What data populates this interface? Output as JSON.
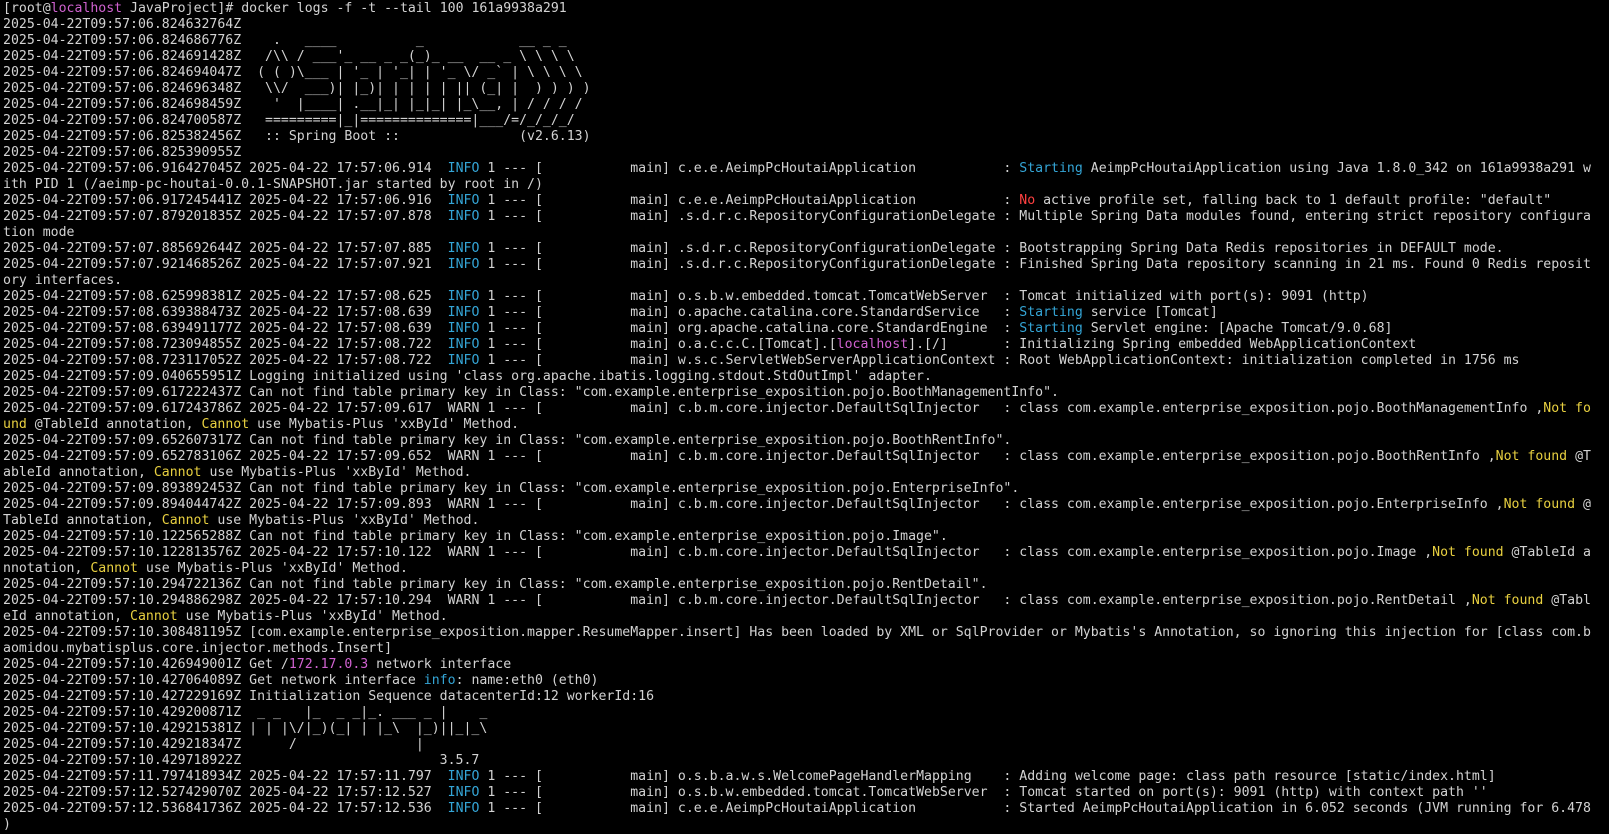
{
  "colors": {
    "default": "#d3d3d3",
    "host": "#d062d0",
    "info": "#34a5d6",
    "warn": "#d3d3d3",
    "ok": "#34a5d6",
    "error": "#ff4040",
    "caution": "#e8d040",
    "magenta": "#d062d0"
  },
  "terminal": {
    "lines": [
      [
        {
          "t": "[root@"
        },
        {
          "t": "localhost",
          "c": "host"
        },
        {
          "t": " JavaProject]# docker logs -f -t --tail 100 161a9938a291"
        }
      ],
      [
        {
          "t": "2025-04-22T09:57:06.824632764Z"
        }
      ],
      [
        {
          "t": "2025-04-22T09:57:06.824686776Z    .   ____          _            __ _ _"
        }
      ],
      [
        {
          "t": "2025-04-22T09:57:06.824691428Z   /\\\\ / ___'_ __ _ _(_)_ __  __ _ \\ \\ \\ \\"
        }
      ],
      [
        {
          "t": "2025-04-22T09:57:06.824694047Z  ( ( )\\___ | '_ | '_| | '_ \\/ _` | \\ \\ \\ \\"
        }
      ],
      [
        {
          "t": "2025-04-22T09:57:06.824696348Z   \\\\/  ___)| |_)| | | | | || (_| |  ) ) ) )"
        }
      ],
      [
        {
          "t": "2025-04-22T09:57:06.824698459Z    '  |____| .__|_| |_|_| |_\\__, | / / / /"
        }
      ],
      [
        {
          "t": "2025-04-22T09:57:06.824700587Z   =========|_|==============|___/=/_/_/_/"
        }
      ],
      [
        {
          "t": "2025-04-22T09:57:06.825382456Z   :: Spring Boot ::               (v2.6.13)"
        }
      ],
      [
        {
          "t": "2025-04-22T09:57:06.825390955Z"
        }
      ],
      [
        {
          "t": "2025-04-22T09:57:06.916427045Z 2025-04-22 17:57:06.914  "
        },
        {
          "t": "INFO",
          "c": "info"
        },
        {
          "t": " 1 --- [           main] c.e.e.AeimpPcHoutaiApplication           : "
        },
        {
          "t": "Starting",
          "c": "ok"
        },
        {
          "t": " AeimpPcHoutaiApplication using Java 1.8.0_342 on 161a9938a291 w"
        }
      ],
      [
        {
          "t": "ith PID 1 (/aeimp-pc-houtai-0.0.1-SNAPSHOT.jar started by root in /)"
        }
      ],
      [
        {
          "t": "2025-04-22T09:57:06.917245441Z 2025-04-22 17:57:06.916  "
        },
        {
          "t": "INFO",
          "c": "info"
        },
        {
          "t": " 1 --- [           main] c.e.e.AeimpPcHoutaiApplication           : "
        },
        {
          "t": "No",
          "c": "error"
        },
        {
          "t": " active profile set, falling back to 1 default profile: \"default\""
        }
      ],
      [
        {
          "t": "2025-04-22T09:57:07.879201835Z 2025-04-22 17:57:07.878  "
        },
        {
          "t": "INFO",
          "c": "info"
        },
        {
          "t": " 1 --- [           main] .s.d.r.c.RepositoryConfigurationDelegate : Multiple Spring Data modules found, entering strict repository configura"
        }
      ],
      [
        {
          "t": "tion mode"
        }
      ],
      [
        {
          "t": "2025-04-22T09:57:07.885692644Z 2025-04-22 17:57:07.885  "
        },
        {
          "t": "INFO",
          "c": "info"
        },
        {
          "t": " 1 --- [           main] .s.d.r.c.RepositoryConfigurationDelegate : Bootstrapping Spring Data Redis repositories in DEFAULT mode."
        }
      ],
      [
        {
          "t": "2025-04-22T09:57:07.921468526Z 2025-04-22 17:57:07.921  "
        },
        {
          "t": "INFO",
          "c": "info"
        },
        {
          "t": " 1 --- [           main] .s.d.r.c.RepositoryConfigurationDelegate : Finished Spring Data repository scanning in 21 ms. Found 0 Redis reposit"
        }
      ],
      [
        {
          "t": "ory interfaces."
        }
      ],
      [
        {
          "t": "2025-04-22T09:57:08.625998381Z 2025-04-22 17:57:08.625  "
        },
        {
          "t": "INFO",
          "c": "info"
        },
        {
          "t": " 1 --- [           main] o.s.b.w.embedded.tomcat.TomcatWebServer  : Tomcat initialized with port(s): 9091 (http)"
        }
      ],
      [
        {
          "t": "2025-04-22T09:57:08.639388473Z 2025-04-22 17:57:08.639  "
        },
        {
          "t": "INFO",
          "c": "info"
        },
        {
          "t": " 1 --- [           main] o.apache.catalina.core.StandardService   : "
        },
        {
          "t": "Starting",
          "c": "ok"
        },
        {
          "t": " service [Tomcat]"
        }
      ],
      [
        {
          "t": "2025-04-22T09:57:08.639491177Z 2025-04-22 17:57:08.639  "
        },
        {
          "t": "INFO",
          "c": "info"
        },
        {
          "t": " 1 --- [           main] org.apache.catalina.core.StandardEngine  : "
        },
        {
          "t": "Starting",
          "c": "ok"
        },
        {
          "t": " Servlet engine: [Apache Tomcat/9.0.68]"
        }
      ],
      [
        {
          "t": "2025-04-22T09:57:08.723094855Z 2025-04-22 17:57:08.722  "
        },
        {
          "t": "INFO",
          "c": "info"
        },
        {
          "t": " 1 --- [           main] o.a.c.c.C.[Tomcat].["
        },
        {
          "t": "localhost",
          "c": "magenta"
        },
        {
          "t": "].[/]       : Initializing Spring embedded WebApplicationContext"
        }
      ],
      [
        {
          "t": "2025-04-22T09:57:08.723117052Z 2025-04-22 17:57:08.722  "
        },
        {
          "t": "INFO",
          "c": "info"
        },
        {
          "t": " 1 --- [           main] w.s.c.ServletWebServerApplicationContext : Root WebApplicationContext: initialization completed in 1756 ms"
        }
      ],
      [
        {
          "t": "2025-04-22T09:57:09.040655951Z Logging initialized using 'class org.apache.ibatis.logging.stdout.StdOutImpl' adapter."
        }
      ],
      [
        {
          "t": "2025-04-22T09:57:09.617222437Z Can not find table primary key in Class: \"com.example.enterprise_exposition.pojo.BoothManagementInfo\"."
        }
      ],
      [
        {
          "t": "2025-04-22T09:57:09.617243786Z 2025-04-22 17:57:09.617  "
        },
        {
          "t": "WARN",
          "c": "warn"
        },
        {
          "t": " 1 --- [           main] c.b.m.core.injector.DefaultSqlInjector   : class com.example.enterprise_exposition.pojo.BoothManagementInfo ,"
        },
        {
          "t": "Not fo",
          "c": "caution"
        }
      ],
      [
        {
          "t": "und",
          "c": "caution"
        },
        {
          "t": " @TableId annotation, "
        },
        {
          "t": "Cannot",
          "c": "caution"
        },
        {
          "t": " use Mybatis-Plus 'xxById' Method."
        }
      ],
      [
        {
          "t": "2025-04-22T09:57:09.652607317Z Can not find table primary key in Class: \"com.example.enterprise_exposition.pojo.BoothRentInfo\"."
        }
      ],
      [
        {
          "t": "2025-04-22T09:57:09.652783106Z 2025-04-22 17:57:09.652  "
        },
        {
          "t": "WARN",
          "c": "warn"
        },
        {
          "t": " 1 --- [           main] c.b.m.core.injector.DefaultSqlInjector   : class com.example.enterprise_exposition.pojo.BoothRentInfo ,"
        },
        {
          "t": "Not found",
          "c": "caution"
        },
        {
          "t": " @T"
        }
      ],
      [
        {
          "t": "ableId annotation, "
        },
        {
          "t": "Cannot",
          "c": "caution"
        },
        {
          "t": " use Mybatis-Plus 'xxById' Method."
        }
      ],
      [
        {
          "t": "2025-04-22T09:57:09.893892453Z Can not find table primary key in Class: \"com.example.enterprise_exposition.pojo.EnterpriseInfo\"."
        }
      ],
      [
        {
          "t": "2025-04-22T09:57:09.894044742Z 2025-04-22 17:57:09.893  "
        },
        {
          "t": "WARN",
          "c": "warn"
        },
        {
          "t": " 1 --- [           main] c.b.m.core.injector.DefaultSqlInjector   : class com.example.enterprise_exposition.pojo.EnterpriseInfo ,"
        },
        {
          "t": "Not found",
          "c": "caution"
        },
        {
          "t": " @"
        }
      ],
      [
        {
          "t": "TableId annotation, "
        },
        {
          "t": "Cannot",
          "c": "caution"
        },
        {
          "t": " use Mybatis-Plus 'xxById' Method."
        }
      ],
      [
        {
          "t": "2025-04-22T09:57:10.122565288Z Can not find table primary key in Class: \"com.example.enterprise_exposition.pojo.Image\"."
        }
      ],
      [
        {
          "t": "2025-04-22T09:57:10.122813576Z 2025-04-22 17:57:10.122  "
        },
        {
          "t": "WARN",
          "c": "warn"
        },
        {
          "t": " 1 --- [           main] c.b.m.core.injector.DefaultSqlInjector   : class com.example.enterprise_exposition.pojo.Image ,"
        },
        {
          "t": "Not found",
          "c": "caution"
        },
        {
          "t": " @TableId a"
        }
      ],
      [
        {
          "t": "nnotation, "
        },
        {
          "t": "Cannot",
          "c": "caution"
        },
        {
          "t": " use Mybatis-Plus 'xxById' Method."
        }
      ],
      [
        {
          "t": "2025-04-22T09:57:10.294722136Z Can not find table primary key in Class: \"com.example.enterprise_exposition.pojo.RentDetail\"."
        }
      ],
      [
        {
          "t": "2025-04-22T09:57:10.294886298Z 2025-04-22 17:57:10.294  "
        },
        {
          "t": "WARN",
          "c": "warn"
        },
        {
          "t": " 1 --- [           main] c.b.m.core.injector.DefaultSqlInjector   : class com.example.enterprise_exposition.pojo.RentDetail ,"
        },
        {
          "t": "Not found",
          "c": "caution"
        },
        {
          "t": " @Tabl"
        }
      ],
      [
        {
          "t": "eId annotation, "
        },
        {
          "t": "Cannot",
          "c": "caution"
        },
        {
          "t": " use Mybatis-Plus 'xxById' Method."
        }
      ],
      [
        {
          "t": "2025-04-22T09:57:10.308481195Z [com.example.enterprise_exposition.mapper.ResumeMapper.insert] Has been loaded by XML or SqlProvider or Mybatis's Annotation, so ignoring this injection for [class com.b"
        }
      ],
      [
        {
          "t": "aomidou.mybatisplus.core.injector.methods.Insert]"
        }
      ],
      [
        {
          "t": "2025-04-22T09:57:10.426949001Z Get /"
        },
        {
          "t": "172.17.0.3",
          "c": "magenta"
        },
        {
          "t": " network interface"
        }
      ],
      [
        {
          "t": "2025-04-22T09:57:10.427064089Z Get network interface "
        },
        {
          "t": "info",
          "c": "info"
        },
        {
          "t": ": name:eth0 (eth0)"
        }
      ],
      [
        {
          "t": "2025-04-22T09:57:10.427229169Z Initialization Sequence datacenterId:12 workerId:16"
        }
      ],
      [
        {
          "t": "2025-04-22T09:57:10.429200871Z  _ _   |_  _ _|_. ___ _ |    _"
        }
      ],
      [
        {
          "t": "2025-04-22T09:57:10.429215381Z | | |\\/|_)(_| | |_\\  |_)||_|_\\"
        }
      ],
      [
        {
          "t": "2025-04-22T09:57:10.429218347Z      /               |"
        }
      ],
      [
        {
          "t": "2025-04-22T09:57:10.429718922Z                         3.5.7"
        }
      ],
      [
        {
          "t": "2025-04-22T09:57:11.797418934Z 2025-04-22 17:57:11.797  "
        },
        {
          "t": "INFO",
          "c": "info"
        },
        {
          "t": " 1 --- [           main] o.s.b.a.w.s.WelcomePageHandlerMapping    : Adding welcome page: class path resource [static/index.html]"
        }
      ],
      [
        {
          "t": "2025-04-22T09:57:12.527429070Z 2025-04-22 17:57:12.527  "
        },
        {
          "t": "INFO",
          "c": "info"
        },
        {
          "t": " 1 --- [           main] o.s.b.w.embedded.tomcat.TomcatWebServer  : Tomcat started on port(s): 9091 (http) with context path ''"
        }
      ],
      [
        {
          "t": "2025-04-22T09:57:12.536841736Z 2025-04-22 17:57:12.536  "
        },
        {
          "t": "INFO",
          "c": "info"
        },
        {
          "t": " 1 --- [           main] c.e.e.AeimpPcHoutaiApplication           : Started AeimpPcHoutaiApplication in 6.052 seconds (JVM running for 6.478"
        }
      ],
      [
        {
          "t": ")"
        }
      ]
    ]
  }
}
